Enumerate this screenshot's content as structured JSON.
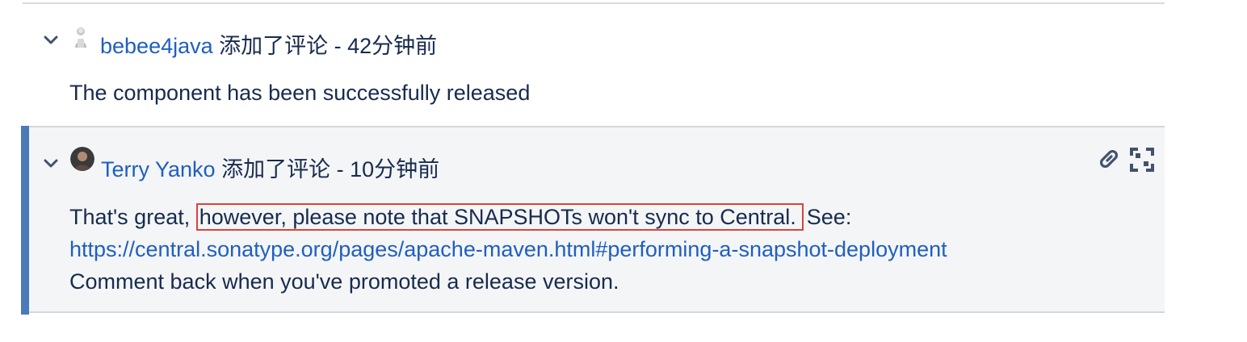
{
  "comments": [
    {
      "author": "bebee4java",
      "action": "添加了评论 - 42分钟前",
      "body": "The component has been successfully released"
    },
    {
      "author": "Terry Yanko",
      "action": "添加了评论 - 10分钟前",
      "body_prefix": "That's great,",
      "body_highlight": "however, please note that SNAPSHOTs won't sync to Central.",
      "body_suffix": "See:",
      "link": "https://central.sonatype.org/pages/apache-maven.html#performing-a-snapshot-deployment",
      "body_last": "Comment back when you've promoted a release version."
    }
  ],
  "icons": {
    "collapse": "chevron-down-icon",
    "permalink": "link-icon",
    "expand": "fullscreen-icon"
  },
  "colors": {
    "link": "#1f5fbf",
    "accent_bar": "#4a7ab8",
    "highlight_border": "#d9443a",
    "focused_bg": "#f4f5f7"
  }
}
